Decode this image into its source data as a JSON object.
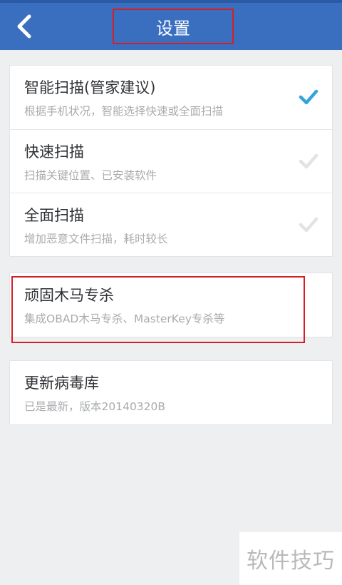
{
  "header": {
    "title": "设置"
  },
  "scan_options": [
    {
      "title": "智能扫描(管家建议)",
      "subtitle": "根据手机状况，智能选择快速或全面扫描",
      "checked": true
    },
    {
      "title": "快速扫描",
      "subtitle": "扫描关键位置、已安装软件",
      "checked": false
    },
    {
      "title": "全面扫描",
      "subtitle": "增加恶意文件扫描，耗时较长",
      "checked": false
    }
  ],
  "trojan_kill": {
    "title": "顽固木马专杀",
    "subtitle": "集成OBAD木马专杀、MasterKey专杀等"
  },
  "virus_db": {
    "title": "更新病毒库",
    "subtitle": "已是最新，版本20140320B"
  },
  "watermark": "软件技巧",
  "colors": {
    "header_bg": "#3a6fc0",
    "check_active": "#33a3dc",
    "check_inactive": "#e2e3e6",
    "highlight_border": "#d41f27"
  }
}
